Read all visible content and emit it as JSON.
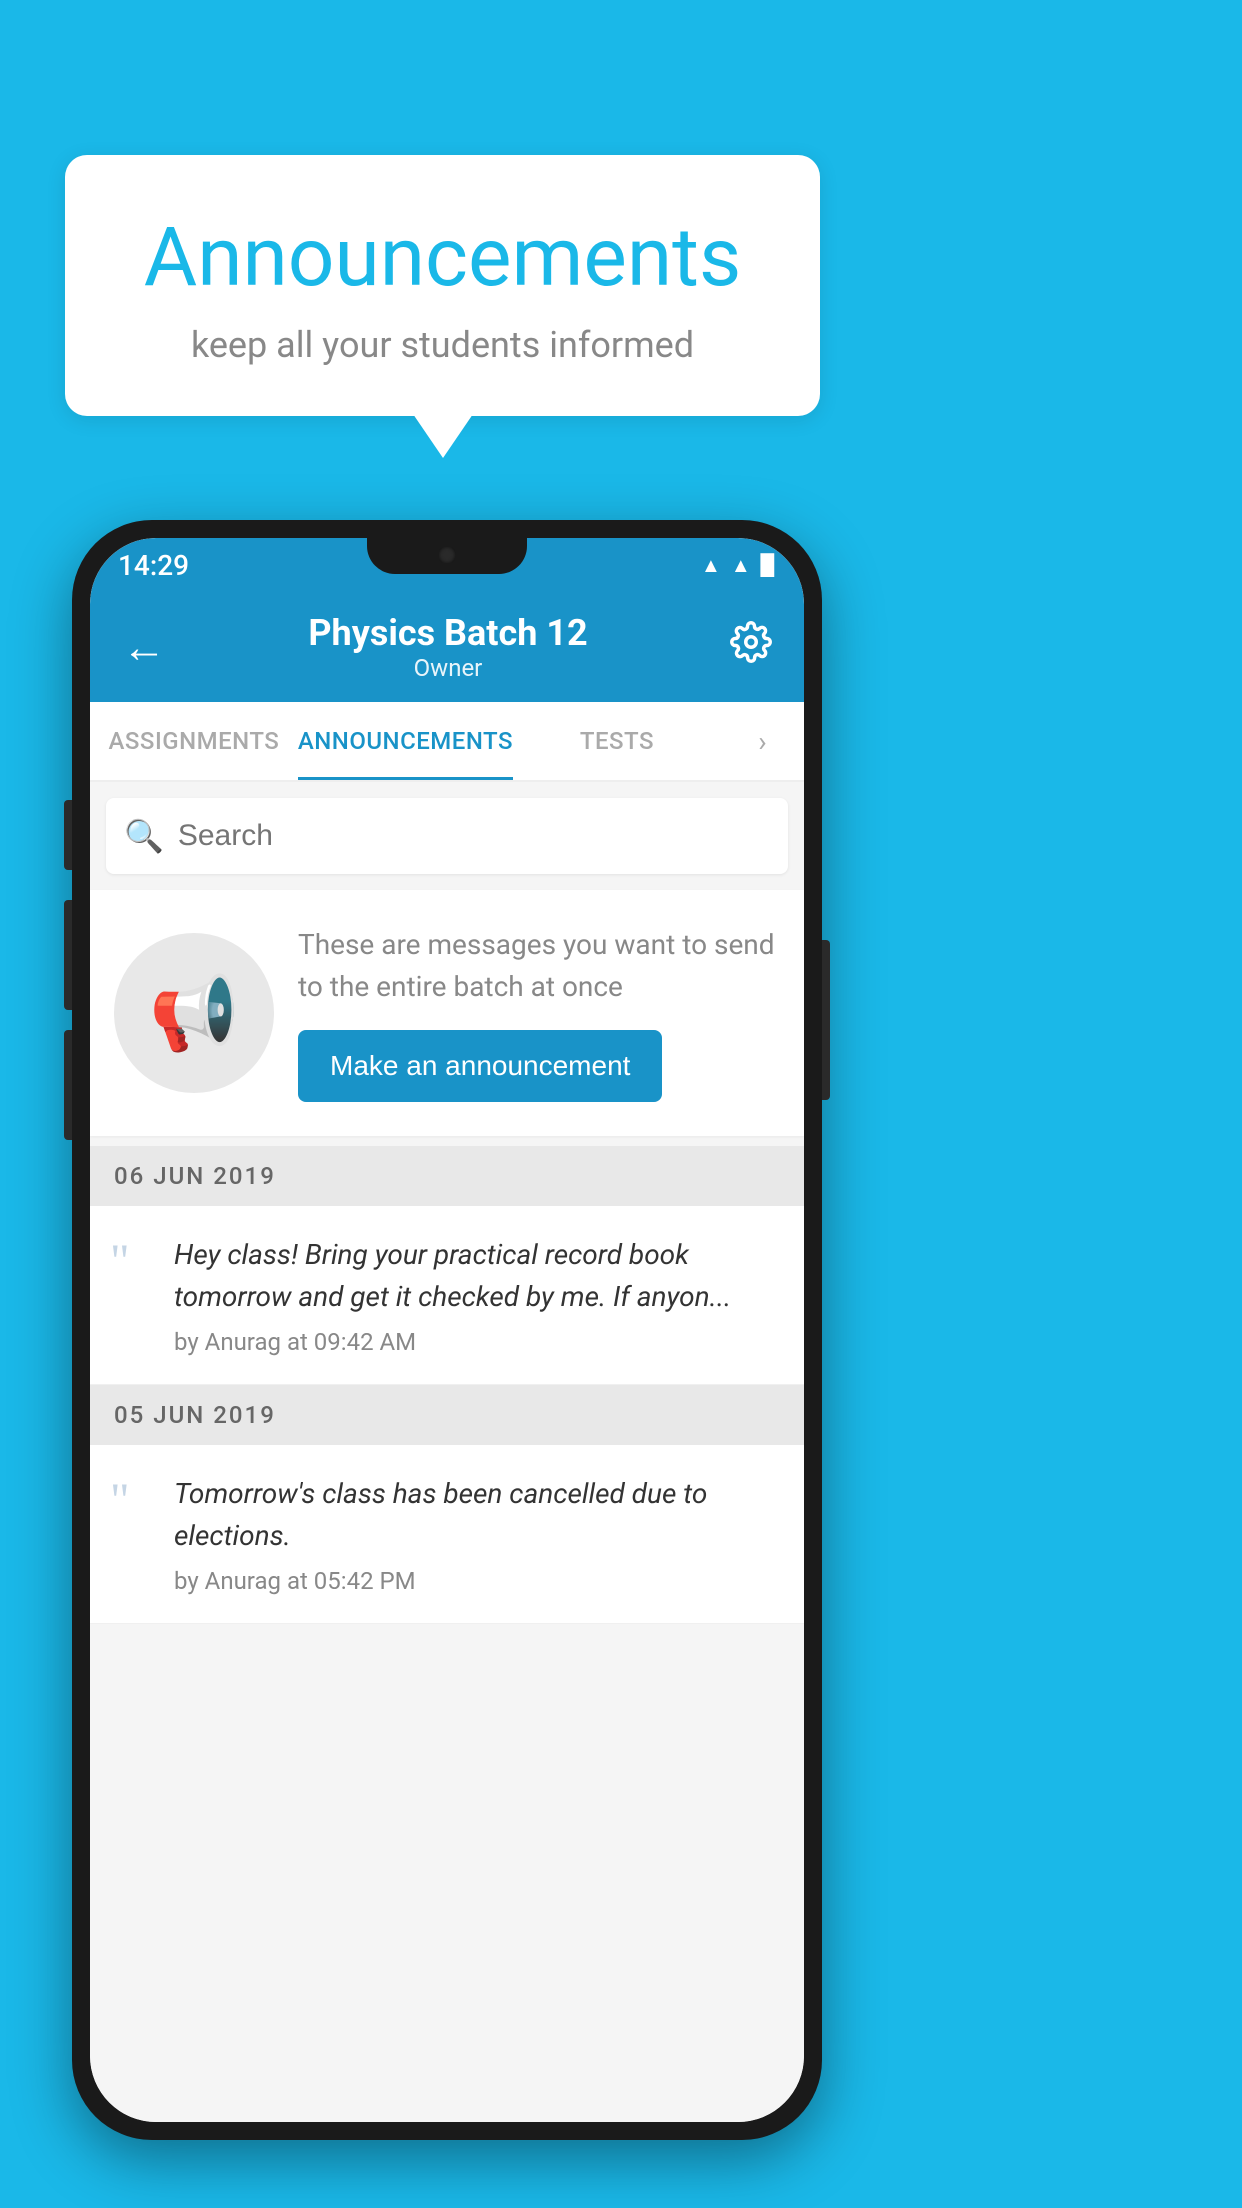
{
  "background_color": "#1ab8e8",
  "speech_bubble": {
    "title": "Announcements",
    "subtitle": "keep all your students informed"
  },
  "phone": {
    "status_bar": {
      "time": "14:29",
      "wifi": "▲",
      "signal": "▲",
      "battery": "▉"
    },
    "app_bar": {
      "title": "Physics Batch 12",
      "subtitle": "Owner",
      "back_label": "←",
      "settings_label": "⚙"
    },
    "tabs": [
      {
        "label": "ASSIGNMENTS",
        "active": false
      },
      {
        "label": "ANNOUNCEMENTS",
        "active": true
      },
      {
        "label": "TESTS",
        "active": false
      }
    ],
    "search": {
      "placeholder": "Search"
    },
    "cta": {
      "description": "These are messages you want to send to the entire batch at once",
      "button_label": "Make an announcement"
    },
    "announcements": [
      {
        "date": "06  JUN  2019",
        "items": [
          {
            "text": "Hey class! Bring your practical record book tomorrow and get it checked by me. If anyon...",
            "meta": "by Anurag at 09:42 AM"
          }
        ]
      },
      {
        "date": "05  JUN  2019",
        "items": [
          {
            "text": "Tomorrow's class has been cancelled due to elections.",
            "meta": "by Anurag at 05:42 PM"
          }
        ]
      }
    ]
  }
}
